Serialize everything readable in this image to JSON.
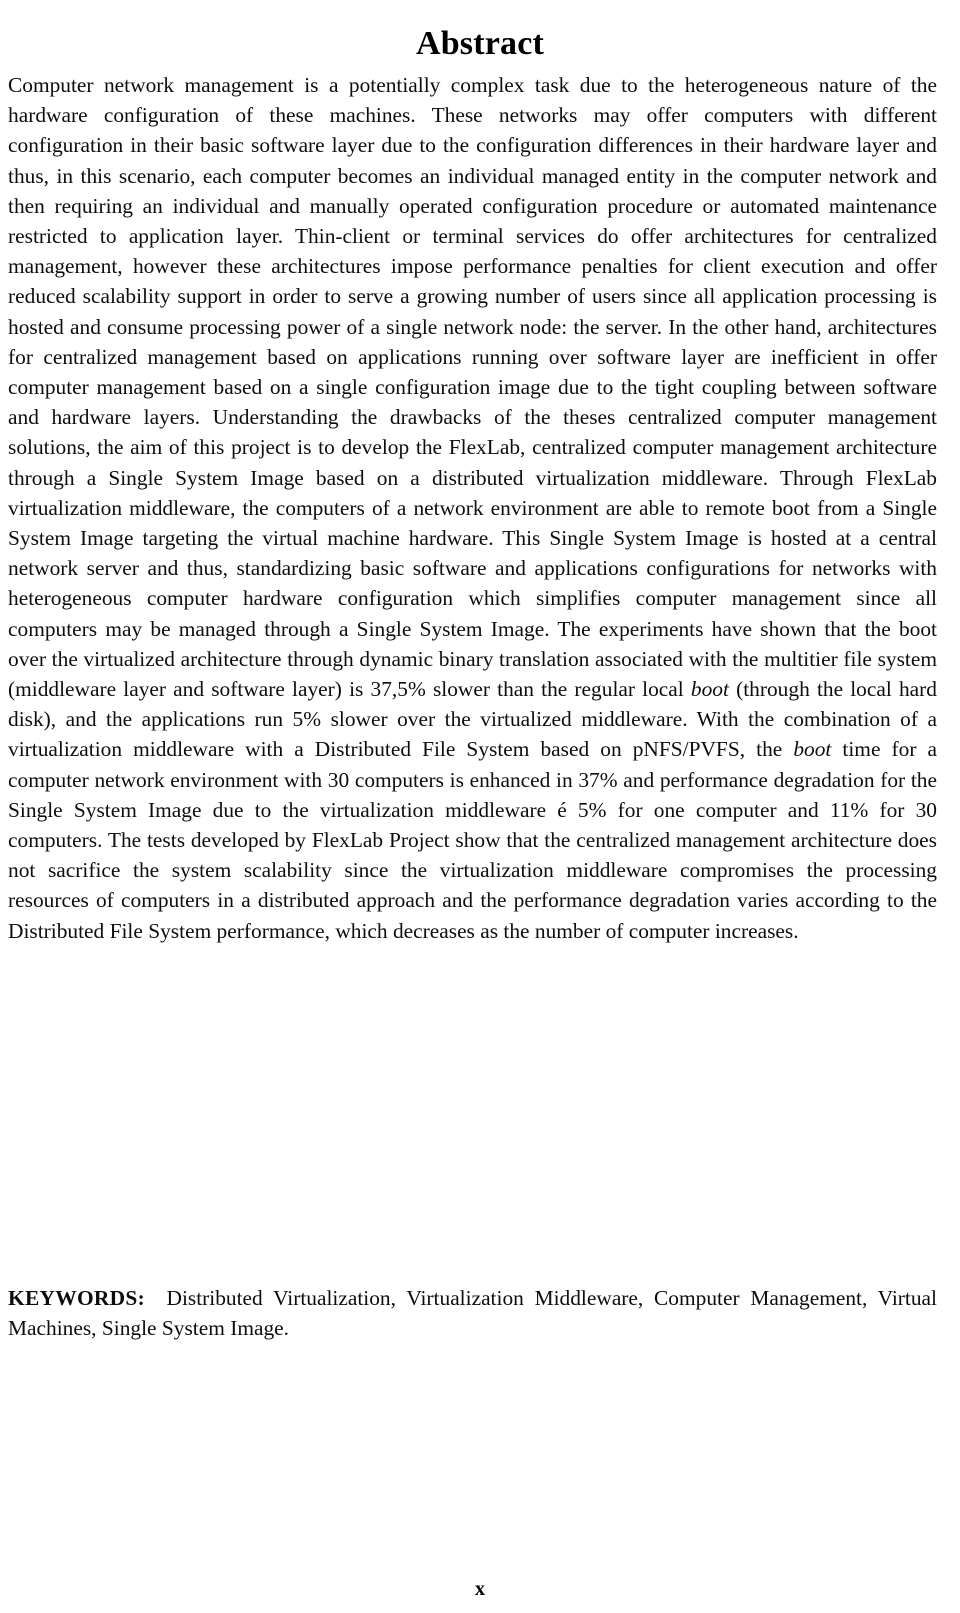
{
  "document": {
    "title": "Abstract",
    "page_number": "x"
  },
  "abstract": {
    "part_1": "Computer network management is a potentially complex task due to the heterogeneous nature of the hardware configuration of these machines. These networks may offer computers with different configuration in their basic software layer due to the configuration differences in their hardware layer and thus, in this scenario, each computer becomes an individual managed entity in the computer network and then requiring an individual and manually operated configuration procedure or automated maintenance restricted to application layer. Thin-client or terminal services do offer architectures for centralized management, however these architectures impose performance penalties for client execution and offer reduced scalability support in order to serve a growing number of users since all application processing is hosted and consume processing power of a single network node: the server. In the other hand, architectures for centralized management based on applications running over software layer are inefficient in offer computer management based on a single configuration image due to the tight coupling between software and hardware layers. Understanding the drawbacks of the theses centralized computer management solutions, the aim of this project is to develop the FlexLab, centralized computer management architecture through a Single System Image based on a distributed virtualization middleware. Through FlexLab virtualization middleware, the computers of a network environment are able to remote boot from a Single System Image targeting the virtual machine hardware. This Single System Image is hosted at a central network server and thus, standardizing basic software and applications configurations for networks with heterogeneous computer hardware configuration which simplifies computer management since all computers may be managed through a Single System Image. The experiments have shown that the boot over the virtualized architecture through dynamic binary translation associated with the multitier file system (middleware layer and software layer) is 37,5% slower than the regular local ",
    "italic_1": "boot",
    "part_2": " (through the local hard disk), and the applications run 5% slower over the virtualized middleware. With the combination of a virtualization middleware with a Distributed File System based on pNFS/PVFS, the ",
    "italic_2": "boot",
    "part_3": " time for a computer network environment with 30 computers is enhanced in 37% and performance degradation for the Single System Image due to the virtualization middleware é 5% for one computer and 11% for 30 computers. The tests developed by FlexLab Project show that the centralized management architecture does not sacrifice the system scalability since the virtualization middleware compromises the processing resources of computers in a distributed approach and the performance degradation varies according to the Distributed File System performance, which decreases as the number of computer increases."
  },
  "keywords": {
    "label": "KEYWORDS:",
    "list": "Distributed Virtualization, Virtualization Middleware, Computer Management, Virtual Machines, Single System Image."
  }
}
